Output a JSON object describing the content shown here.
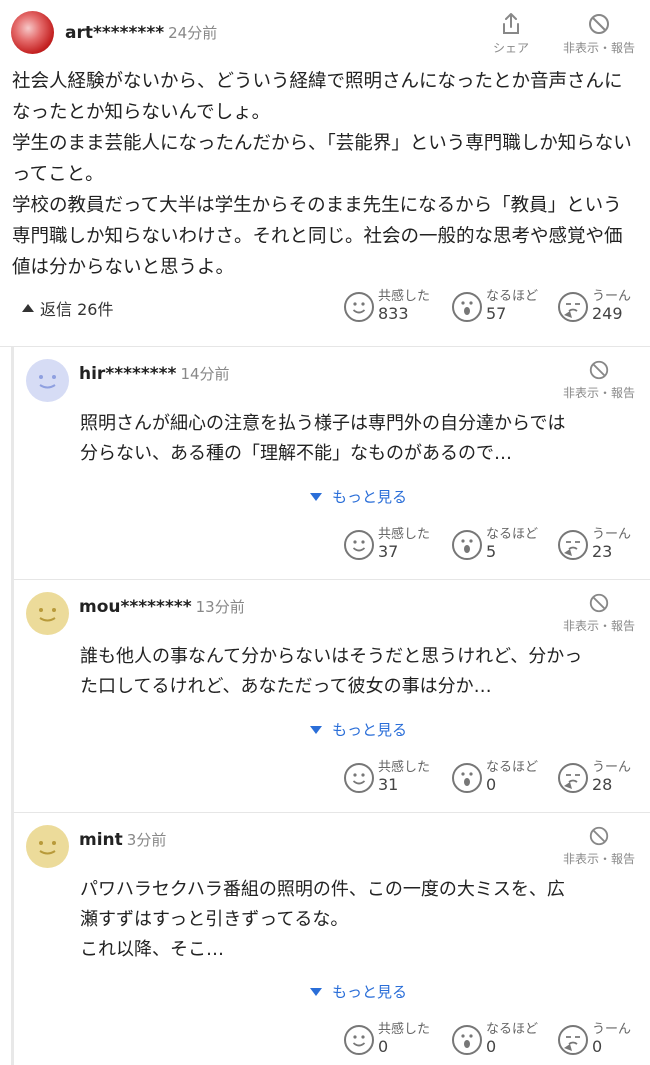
{
  "main_comment": {
    "username": "art********",
    "time": "24分前",
    "share_label": "シェア",
    "hide_label": "非表示・報告",
    "paragraphs": [
      "社会人経験がないから、どういう経緯で照明さんになったとか音声さんになったとか知らないんでしょ。",
      "学生のまま芸能人になったんだから、「芸能界」という専門職しか知らないってこと。",
      "学校の教員だって大半は学生からそのまま先生になるから「教員」という専門職しか知らないわけさ。それと同じ。社会の一般的な思考や感覚や価値は分からないと思うよ。"
    ],
    "replies_label": "返信 26件",
    "reactions": {
      "empathy_label": "共感した",
      "empathy": "833",
      "naruhodo_label": "なるほど",
      "naruhodo": "57",
      "uun_label": "うーん",
      "uun": "249"
    }
  },
  "replies": [
    {
      "username": "hir********",
      "time": "14分前",
      "hide_label": "非表示・報告",
      "avatar_color": "#d6dcf5",
      "lines": [
        "照明さんが細心の注意を払う様子は専門外の自分達からでは",
        "分らない、ある種の「理解不能」なものがあるので…"
      ],
      "more_label": "もっと見る",
      "reactions": {
        "empathy_label": "共感した",
        "empathy": "37",
        "naruhodo_label": "なるほど",
        "naruhodo": "5",
        "uun_label": "うーん",
        "uun": "23"
      }
    },
    {
      "username": "mou********",
      "time": "13分前",
      "hide_label": "非表示・報告",
      "avatar_color": "#ecdb9a",
      "lines": [
        "誰も他人の事なんて分からないはそうだと思うけれど、分かっ",
        "た口してるけれど、あなただって彼女の事は分か…"
      ],
      "more_label": "もっと見る",
      "reactions": {
        "empathy_label": "共感した",
        "empathy": "31",
        "naruhodo_label": "なるほど",
        "naruhodo": "0",
        "uun_label": "うーん",
        "uun": "28"
      }
    },
    {
      "username": "mint",
      "time": "3分前",
      "hide_label": "非表示・報告",
      "avatar_color": "#ecdb9a",
      "lines": [
        "パワハラセクハラ番組の照明の件、この一度の大ミスを、広",
        "瀬すずはすっと引きずってるな。",
        "これ以降、そこ…"
      ],
      "more_label": "もっと見る",
      "reactions": {
        "empathy_label": "共感した",
        "empathy": "0",
        "naruhodo_label": "なるほど",
        "naruhodo": "0",
        "uun_label": "うーん",
        "uun": "0"
      }
    }
  ]
}
